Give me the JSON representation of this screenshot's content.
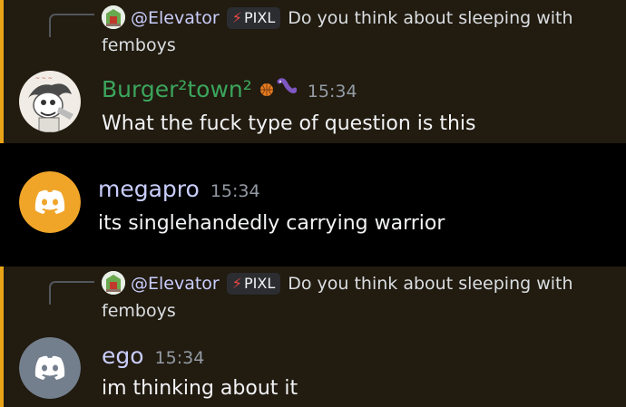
{
  "messages": [
    {
      "reply": {
        "name": "@Elevator",
        "tag": "PIXL",
        "text": "Do you think about sleeping with femboys"
      },
      "author": "Burger²town²",
      "time": "15:34",
      "text": "What the fuck type of question is this"
    },
    {
      "author": "megapro",
      "time": "15:34",
      "text": "its singlehandedly carrying warrior"
    },
    {
      "reply": {
        "name": "@Elevator",
        "tag": "PIXL",
        "text": "Do you think about sleeping with femboys"
      },
      "author": "ego",
      "time": "15:34",
      "text": "im thinking about it"
    }
  ],
  "colors": {
    "highlight_bg": "#211b10",
    "highlight_bar": "#e8a317",
    "discord_orange": "#f0a529",
    "discord_grey": "#747f8d",
    "author_green": "#3ba55c",
    "author_lavender": "#c9cdfb"
  },
  "icons": [
    "reply-avatar-icon",
    "bolt-icon",
    "basketball-icon",
    "worm-icon",
    "discord-logo-icon"
  ]
}
